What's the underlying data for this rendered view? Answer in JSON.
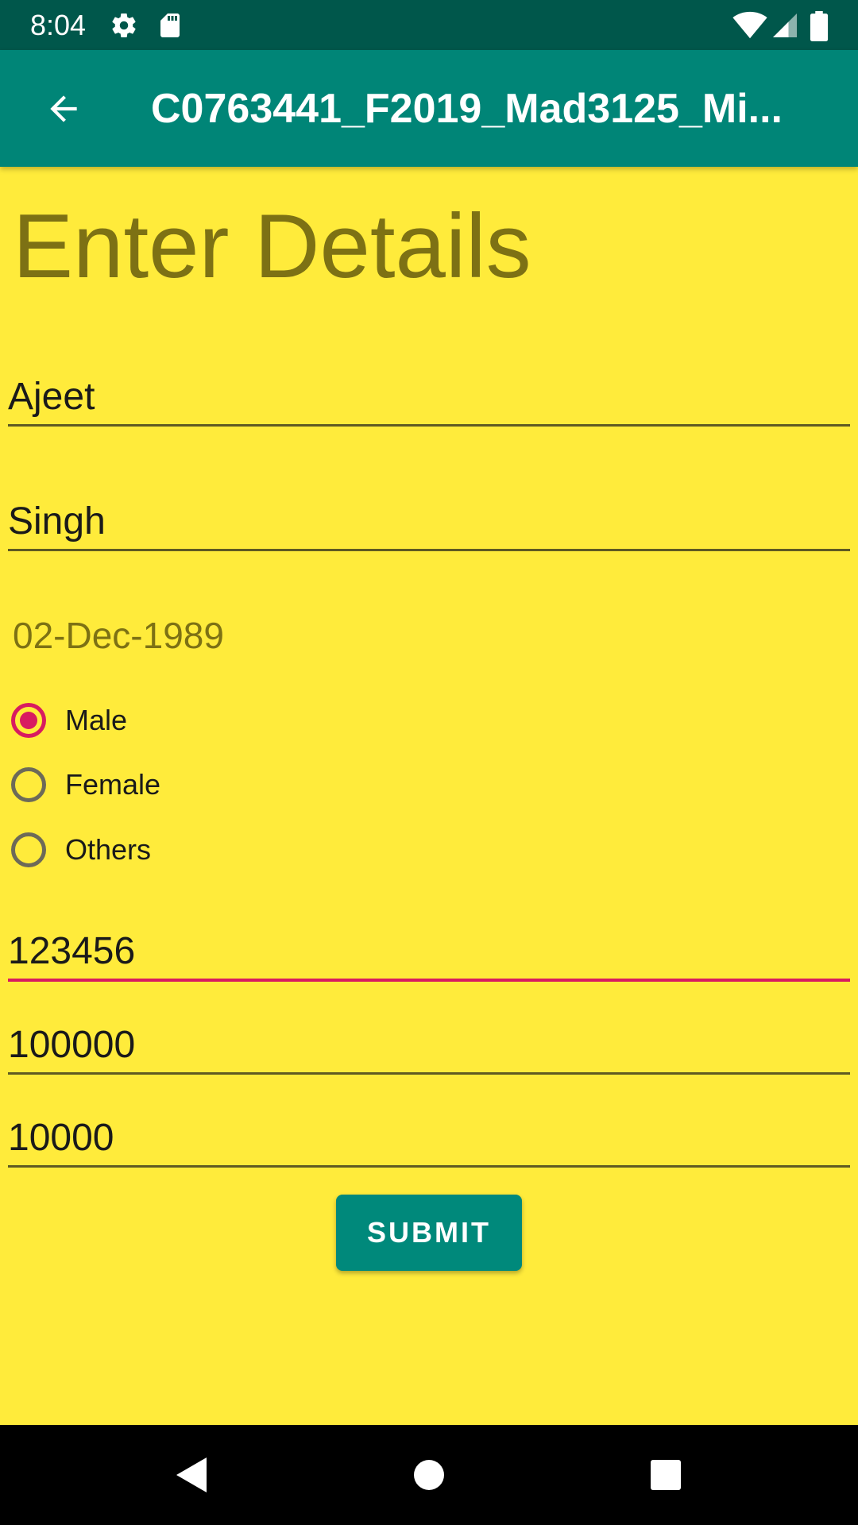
{
  "status_bar": {
    "time": "8:04",
    "icons_left": [
      "settings-icon",
      "sd-card-icon"
    ],
    "icons_right": [
      "wifi-icon",
      "cell-signal-icon",
      "battery-icon"
    ]
  },
  "app_bar": {
    "title": "C0763441_F2019_Mad3125_Mi...",
    "back_icon": "arrow-back-icon"
  },
  "form": {
    "heading": "Enter Details",
    "first_name": "Ajeet",
    "last_name": "Singh",
    "birth_date": "02-Dec-1989",
    "gender_options": [
      {
        "label": "Male",
        "checked": true
      },
      {
        "label": "Female",
        "checked": false
      },
      {
        "label": "Others",
        "checked": false
      }
    ],
    "field_1": "123456",
    "field_2": "100000",
    "field_3": "10000",
    "submit_label": "SUBMIT"
  },
  "nav_bar": {
    "icons": [
      "back-triangle-icon",
      "home-circle-icon",
      "recents-square-icon"
    ]
  },
  "colors": {
    "background": "#ffeb3b",
    "app_bar": "#008577",
    "status_bar": "#00574b",
    "accent": "#d81b60",
    "heading_text": "#7d7114"
  }
}
